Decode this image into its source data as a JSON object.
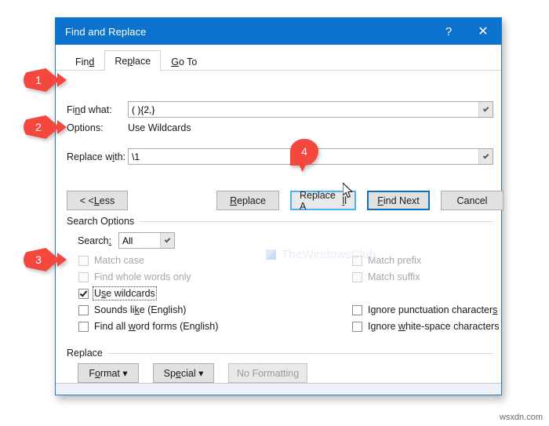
{
  "window": {
    "title": "Find and Replace",
    "help_icon": "?",
    "close_icon": "✕"
  },
  "tabs": [
    {
      "label_pre": "Fin",
      "label_accel": "d",
      "label_post": "",
      "active": false,
      "name": "tab-find"
    },
    {
      "label_pre": "Re",
      "label_accel": "p",
      "label_post": "lace",
      "active": true,
      "name": "tab-replace"
    },
    {
      "label_pre": "",
      "label_accel": "G",
      "label_post": "o To",
      "active": false,
      "name": "tab-goto"
    }
  ],
  "fields": {
    "find_what_label_pre": "Fi",
    "find_what_label_accel": "n",
    "find_what_label_post": "d what:",
    "find_what_value": "( ){2,}",
    "options_label": "Options:",
    "options_value": "Use Wildcards",
    "replace_with_label_pre": "Replace w",
    "replace_with_label_accel": "i",
    "replace_with_label_post": "th:",
    "replace_with_value": "\\1"
  },
  "buttons": {
    "less_pre": "< < ",
    "less_accel": "L",
    "less_post": "ess",
    "replace_pre": "",
    "replace_accel": "R",
    "replace_post": "eplace",
    "replace_all_pre": "Replace A",
    "replace_all_accel": "l",
    "replace_all_post": "l",
    "find_next_pre": "",
    "find_next_accel": "F",
    "find_next_post": "ind Next",
    "cancel": "Cancel"
  },
  "search_options": {
    "group_title": "Search Options",
    "search_label_pre": "Search",
    "search_label_accel": ":",
    "search_value": "All",
    "checkboxes_left": [
      {
        "label_pre": "Match case",
        "accel": "",
        "label_post": "",
        "checked": false,
        "disabled": true,
        "name": "checkbox-match-case"
      },
      {
        "label_pre": "Find whole words only",
        "accel": "",
        "label_post": "",
        "checked": false,
        "disabled": true,
        "name": "checkbox-find-whole-words-only"
      },
      {
        "label_pre": "U",
        "accel": "s",
        "label_post": "e wildcards",
        "checked": true,
        "disabled": false,
        "name": "checkbox-use-wildcards"
      },
      {
        "label_pre": "Sounds li",
        "accel": "k",
        "label_post": "e (English)",
        "checked": false,
        "disabled": false,
        "name": "checkbox-sounds-like"
      },
      {
        "label_pre": "Find all ",
        "accel": "w",
        "label_post": "ord forms (English)",
        "checked": false,
        "disabled": false,
        "name": "checkbox-find-all-word-forms"
      }
    ],
    "checkboxes_right": [
      {
        "label_pre": "Match prefix",
        "accel": "",
        "label_post": "",
        "checked": false,
        "disabled": true,
        "name": "checkbox-match-prefix"
      },
      {
        "label_pre": "Match suffix",
        "accel": "",
        "label_post": "",
        "checked": false,
        "disabled": true,
        "name": "checkbox-match-suffix"
      },
      {
        "label_pre": "Ignore punctuation character",
        "accel": "s",
        "label_post": "",
        "checked": false,
        "disabled": false,
        "name": "checkbox-ignore-punctuation"
      },
      {
        "label_pre": "Ignore ",
        "accel": "w",
        "label_post": "hite-space characters",
        "checked": false,
        "disabled": false,
        "name": "checkbox-ignore-whitespace"
      }
    ]
  },
  "replace_section": {
    "group_title": "Replace",
    "format_pre": "F",
    "format_accel": "o",
    "format_post": "rmat",
    "special_pre": "Sp",
    "special_accel": "e",
    "special_post": "cial",
    "no_formatting": "No Formatting",
    "dropdown_glyph": "▾"
  },
  "callouts": [
    {
      "number": "1",
      "name": "callout-badge-1"
    },
    {
      "number": "2",
      "name": "callout-badge-2"
    },
    {
      "number": "3",
      "name": "callout-badge-3"
    },
    {
      "number": "4",
      "name": "callout-badge-4"
    }
  ],
  "watermark": {
    "text": "TheWindowsClub"
  },
  "footer_watermark": {
    "text": "wsxdn.com"
  },
  "colors": {
    "title_bar": "#0b72cd",
    "badge_red": "#f4483f",
    "focus_blue": "#4ab1f5",
    "default_blue": "#0b6fc4"
  }
}
